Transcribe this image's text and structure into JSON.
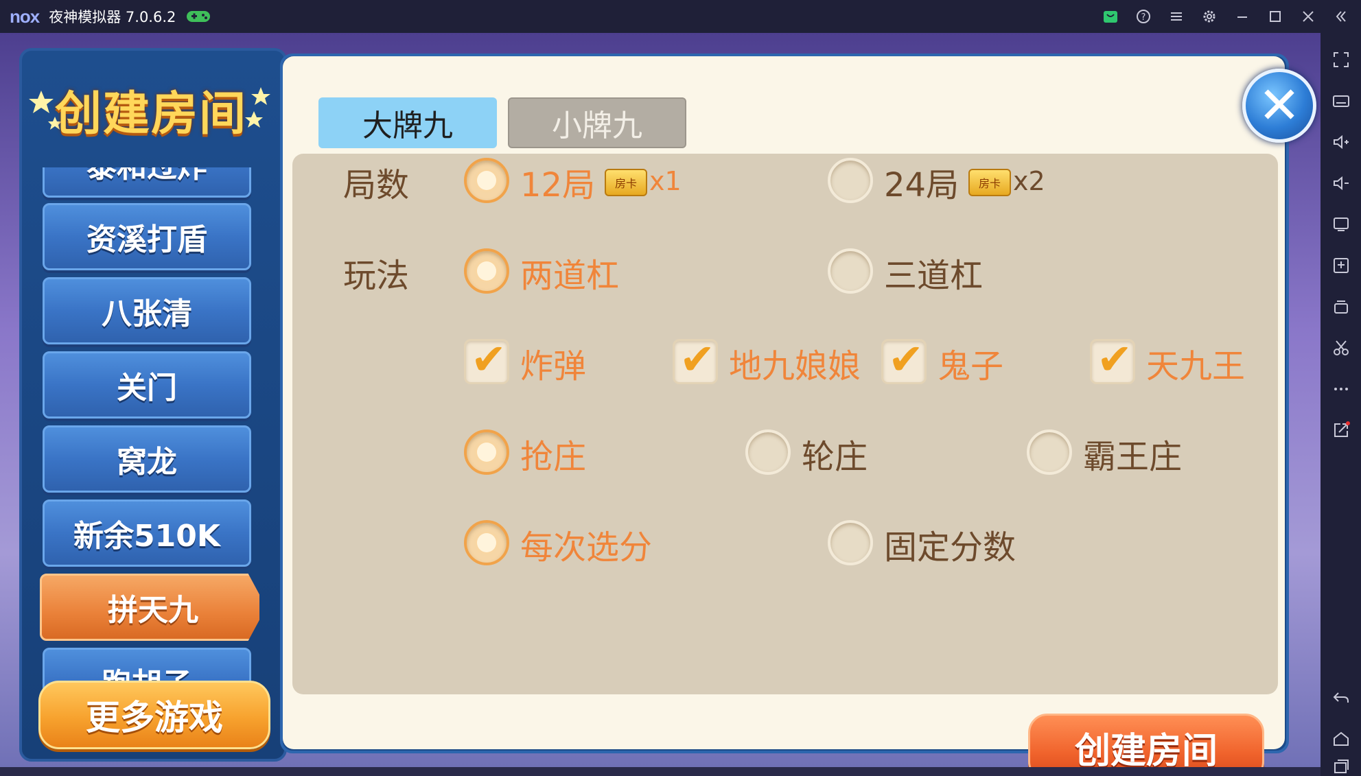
{
  "window": {
    "logo": "nox",
    "title": "夜神模拟器 7.0.6.2"
  },
  "titlebar_icons": [
    "app-market-icon",
    "help-icon",
    "menu-icon",
    "settings-icon",
    "minimize-icon",
    "maximize-icon",
    "close-icon",
    "collapse-icon"
  ],
  "sidebar_icons": [
    "fullscreen-icon",
    "keyboard-icon",
    "volume-up-icon",
    "volume-down-icon",
    "screen-icon",
    "apk-install-icon",
    "multi-instance-icon",
    "scissors-icon",
    "more-icon",
    "share-icon",
    "back-icon",
    "home-icon",
    "recent-apps-icon"
  ],
  "left_panel": {
    "title": "创建房间",
    "menu_items": [
      "泰和过炸",
      "资溪打盾",
      "八张清",
      "关门",
      "窝龙",
      "新余510K",
      "拼天九",
      "跑胡子"
    ],
    "active_item": "拼天九",
    "more_games": "更多游戏"
  },
  "main_panel": {
    "tabs": [
      {
        "label": "大牌九",
        "active": true
      },
      {
        "label": "小牌九",
        "active": false
      }
    ],
    "rounds": {
      "label": "局数",
      "options": [
        {
          "text": "12局",
          "badge": "房卡",
          "multiplier": "x1",
          "selected": true
        },
        {
          "text": "24局",
          "badge": "房卡",
          "multiplier": "x2",
          "selected": false
        }
      ]
    },
    "play_mode": {
      "label": "玩法",
      "options": [
        {
          "text": "两道杠",
          "selected": true
        },
        {
          "text": "三道杠",
          "selected": false
        }
      ]
    },
    "features": [
      {
        "text": "炸弹",
        "checked": true
      },
      {
        "text": "地九娘娘",
        "checked": true
      },
      {
        "text": "鬼子",
        "checked": true
      },
      {
        "text": "天九王",
        "checked": true
      }
    ],
    "banker_mode": [
      {
        "text": "抢庄",
        "selected": true
      },
      {
        "text": "轮庄",
        "selected": false
      },
      {
        "text": "霸王庄",
        "selected": false
      }
    ],
    "score_mode": [
      {
        "text": "每次选分",
        "selected": true
      },
      {
        "text": "固定分数",
        "selected": false
      }
    ],
    "create_button": "创建房间"
  },
  "colors": {
    "selected_text": "#f0853a",
    "unselected_text": "#6d4a2c",
    "panel_bg": "#fbf6e8",
    "options_bg": "#d8cdb9",
    "active_tab": "#8dd2f6"
  }
}
